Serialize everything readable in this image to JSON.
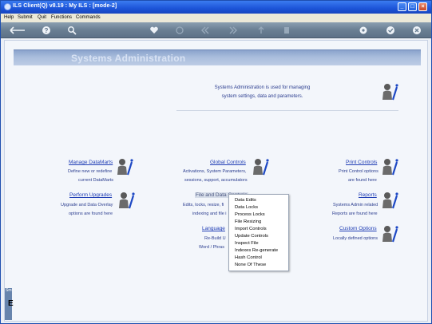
{
  "window": {
    "title": "ILS Client(Q) v8.19 : My ILS :    [mode-2]",
    "controls": [
      "_",
      "□",
      "×"
    ]
  },
  "menubar": [
    "Help",
    "Submit",
    "Quit",
    "Functions",
    "Commands"
  ],
  "toolbar": [
    "back-arrow-icon",
    "help-icon",
    "search-icon",
    "heart-icon",
    "refresh-icon",
    "rewind-icon",
    "forward-icon",
    "up-icon",
    "stop-icon",
    "settings-icon",
    "check-icon",
    "close-icon"
  ],
  "banner": {
    "title": "Systems Administration"
  },
  "intro": {
    "line1": "Systems Administration is used for managing",
    "line2": "system settings, data and parameters."
  },
  "items": {
    "manage_datamarts": {
      "title": "Manage DataMarts",
      "line1": "Define new or redefine",
      "line2": "current DataMarts"
    },
    "global_controls": {
      "title": "Global Controls",
      "line1": "Activations, System Parameters,",
      "line2": "sessions, support, accumulators"
    },
    "print_controls": {
      "title": "Print Controls",
      "line1": "Print Control options",
      "line2": "are found here"
    },
    "perform_upgrades": {
      "title": "Perform Upgrades",
      "line1": "Upgrade and Data Overlay",
      "line2": "options are found here"
    },
    "file_data_controls": {
      "title": "File and Data Controls",
      "line1": "Edits, locks, resize, fi",
      "line2": "indexing and file i"
    },
    "reports": {
      "title": "Reports",
      "line1": "Systems Admin related",
      "line2": "Reports are found here"
    },
    "language": {
      "title": "Language",
      "line1": "Re-Build U",
      "line2": "Word / Phras"
    },
    "custom_options": {
      "title": "Custom Options",
      "line1": "Locally defined options"
    }
  },
  "popup": [
    "Data Edits",
    "Data Locks",
    "Process Locks",
    "File Resizing",
    "Import Controls",
    "Update Controls",
    "Inspect File",
    "Indexes Re-generate",
    "Hash Control",
    "None Of These"
  ],
  "strip": {
    "label": "Sm",
    "letter": "E"
  }
}
